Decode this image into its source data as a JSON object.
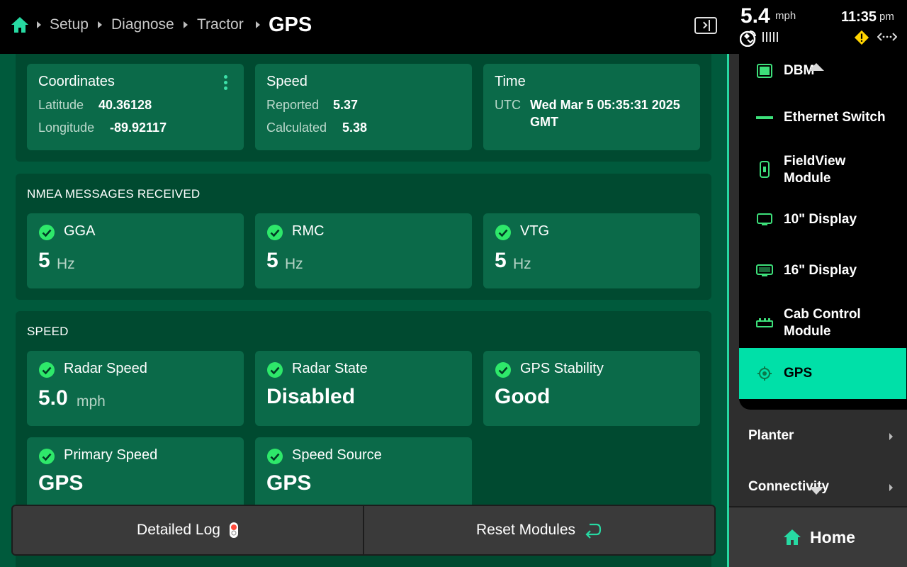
{
  "header": {
    "breadcrumbs": [
      "Setup",
      "Diagnose",
      "Tractor"
    ],
    "current_page": "GPS",
    "speed": "5.4",
    "speed_unit": "mph",
    "time": "11:35",
    "time_ampm": "pm",
    "icons": [
      "home-icon",
      "panel-toggle-icon",
      "satellite-icon",
      "signal-bars-icon",
      "warning-icon",
      "connection-icon"
    ]
  },
  "gps_info": {
    "coordinates": {
      "title": "Coordinates",
      "latitude_label": "Latitude",
      "latitude": "40.36128",
      "longitude_label": "Longitude",
      "longitude": "-89.92117"
    },
    "speed": {
      "title": "Speed",
      "reported_label": "Reported",
      "reported": "5.37",
      "calculated_label": "Calculated",
      "calculated": "5.38"
    },
    "time": {
      "title": "Time",
      "utc_label": "UTC",
      "utc_line1": "Wed Mar 5 05:35:31 2025",
      "utc_line2": "GMT"
    }
  },
  "nmea": {
    "title": "NMEA MESSAGES RECEIVED",
    "messages": [
      {
        "name": "GGA",
        "value": "5",
        "unit": "Hz"
      },
      {
        "name": "RMC",
        "value": "5",
        "unit": "Hz"
      },
      {
        "name": "VTG",
        "value": "5",
        "unit": "Hz"
      }
    ]
  },
  "speed_section": {
    "title": "SPEED",
    "radar_speed": {
      "label": "Radar Speed",
      "value": "5.0",
      "unit": "mph"
    },
    "radar_state": {
      "label": "Radar State",
      "value": "Disabled"
    },
    "gps_stability": {
      "label": "GPS Stability",
      "value": "Good"
    },
    "primary_speed": {
      "label": "Primary Speed",
      "value": "GPS"
    },
    "speed_source": {
      "label": "Speed Source",
      "value": "GPS"
    }
  },
  "footer": {
    "detailed_log": "Detailed Log",
    "reset_modules": "Reset Modules"
  },
  "sidebar": {
    "sub_items": [
      {
        "label": "DBM",
        "icon": "module-icon"
      },
      {
        "label": "Ethernet Switch",
        "icon": "ethernet-icon"
      },
      {
        "label": "FieldView Module",
        "icon": "fieldview-module-icon"
      },
      {
        "label": "10\" Display",
        "icon": "display-icon"
      },
      {
        "label": "16\" Display",
        "icon": "display-icon"
      },
      {
        "label": "Cab Control Module",
        "icon": "cab-control-icon"
      },
      {
        "label": "GPS",
        "icon": "gps-icon",
        "active": true
      }
    ],
    "nav_items": [
      {
        "label": "Planter"
      },
      {
        "label": "Connectivity"
      }
    ],
    "home_label": "Home"
  },
  "colors": {
    "accent": "#00e0a8",
    "main_bg": "#005a3c",
    "section_bg": "#004a30",
    "card_bg": "#0b6a49",
    "warning": "#ffd400",
    "check_green": "#2ee86a"
  }
}
